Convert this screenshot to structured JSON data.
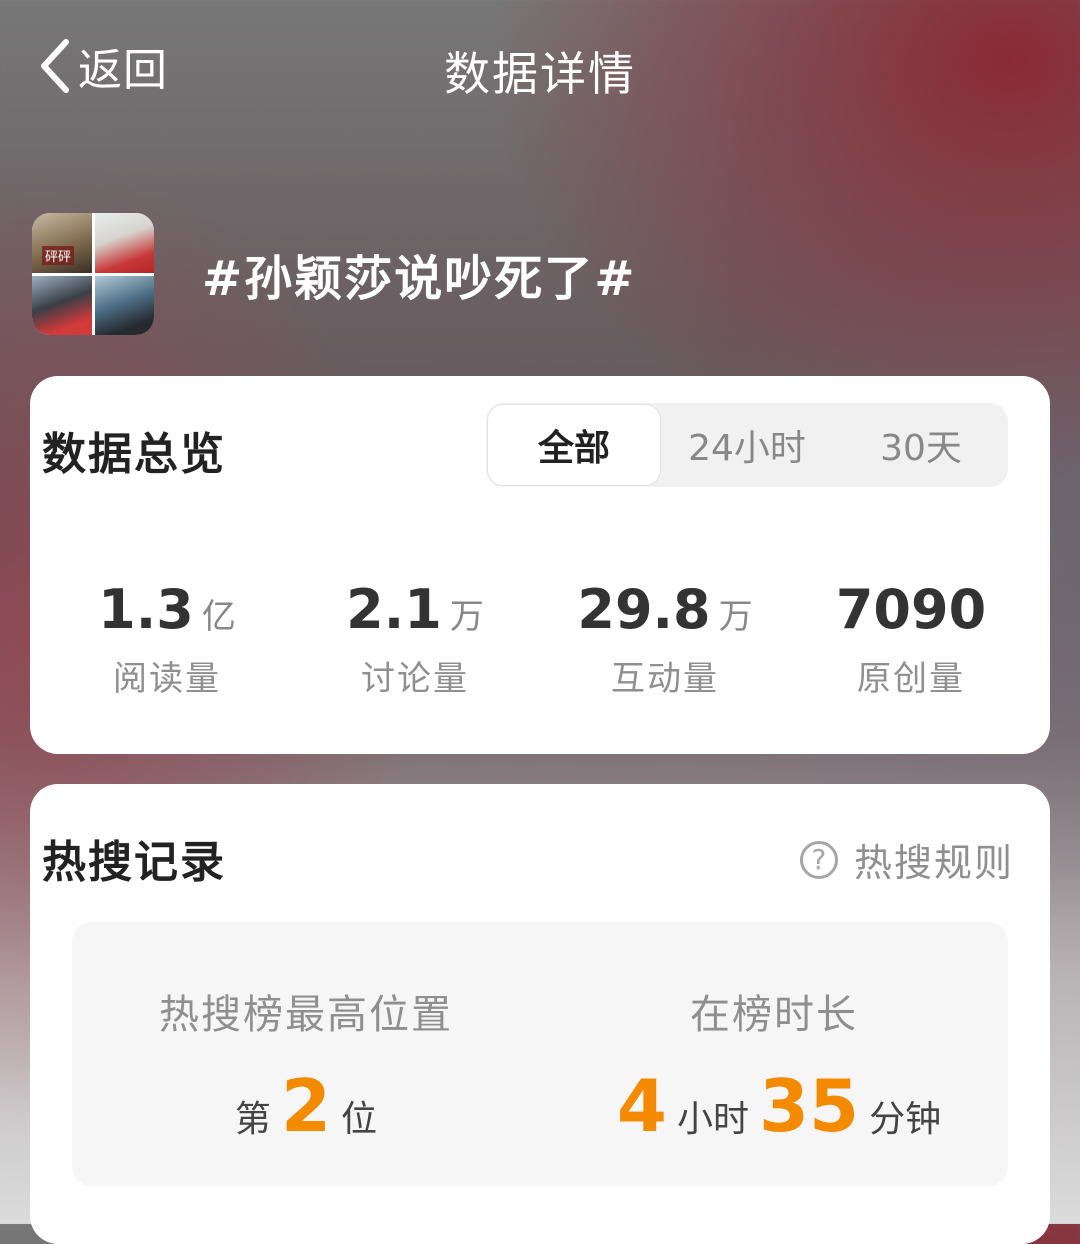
{
  "nav": {
    "back_label": "返回",
    "title": "数据详情"
  },
  "topic": {
    "name": "#孙颖莎说吵死了#",
    "thumb_text": "砰砰"
  },
  "overview": {
    "title": "数据总览",
    "tabs": [
      {
        "label": "全部",
        "active": true
      },
      {
        "label": "24小时",
        "active": false
      },
      {
        "label": "30天",
        "active": false
      }
    ],
    "stats": [
      {
        "value": "1.3",
        "unit": "亿",
        "label": "阅读量"
      },
      {
        "value": "2.1",
        "unit": "万",
        "label": "讨论量"
      },
      {
        "value": "29.8",
        "unit": "万",
        "label": "互动量"
      },
      {
        "value": "7090",
        "unit": "",
        "label": "原创量"
      }
    ]
  },
  "hot": {
    "title": "热搜记录",
    "rules_label": "热搜规则",
    "rules_icon": "question-circle-icon",
    "peak": {
      "label": "热搜榜最高位置",
      "prefix": "第",
      "value": "2",
      "suffix": "位"
    },
    "duration": {
      "label": "在榜时长",
      "hours": "4",
      "hours_unit": "小时",
      "minutes": "35",
      "minutes_unit": "分钟"
    },
    "accent_color": "#f48a00"
  }
}
